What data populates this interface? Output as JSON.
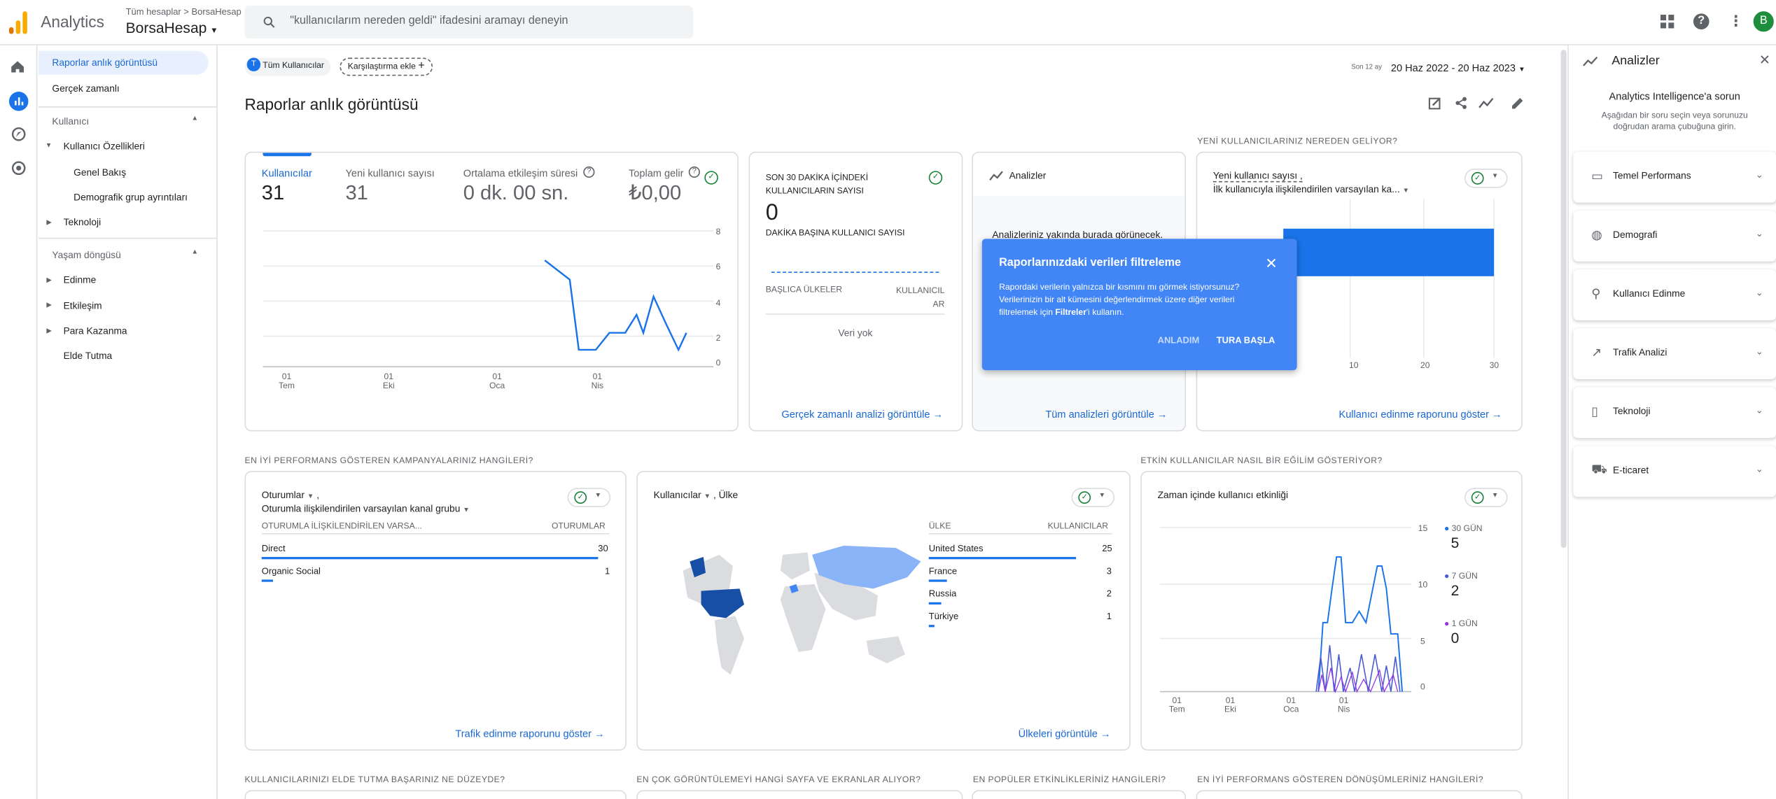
{
  "app": {
    "name": "Analytics",
    "breadcrumb": "Tüm hesaplar > BorsaHesap",
    "account": "BorsaHesap"
  },
  "search": {
    "placeholder": "\"kullanıcılarım nereden geldi\" ifadesini aramayı deneyin"
  },
  "user": {
    "initial": "B"
  },
  "nav": {
    "snapshot": "Raporlar anlık görüntüsü",
    "realtime": "Gerçek zamanlı",
    "user_section": "Kullanıcı",
    "user_attributes": "Kullanıcı Özellikleri",
    "overview": "Genel Bakış",
    "demographic_details": "Demografik grup ayrıntıları",
    "technology": "Teknoloji",
    "lifecycle_section": "Yaşam döngüsü",
    "acquisition": "Edinme",
    "engagement": "Etkileşim",
    "monetization": "Para Kazanma",
    "retention": "Elde Tutma"
  },
  "filters": {
    "all_users": "Tüm Kullanıcılar",
    "all_users_badge": "T",
    "add_comparison": "Karşılaştırma ekle",
    "date_prefix": "Son 12 ay",
    "date_range": "20 Haz 2022 - 20 Haz 2023"
  },
  "page_title": "Raporlar anlık görüntüsü",
  "kpi": {
    "users_label": "Kullanıcılar",
    "users_value": "31",
    "new_users_label": "Yeni kullanıcı sayısı",
    "new_users_value": "31",
    "avg_engagement_label": "Ortalama etkileşim süresi",
    "avg_engagement_value": "0 dk. 00 sn.",
    "revenue_label": "Toplam gelir",
    "revenue_value": "₺0,00",
    "y_ticks": [
      "8",
      "6",
      "4",
      "2",
      "0"
    ],
    "x_ticks": [
      {
        "d": "01",
        "m": "Tem"
      },
      {
        "d": "01",
        "m": "Eki"
      },
      {
        "d": "01",
        "m": "Oca"
      },
      {
        "d": "01",
        "m": "Nis"
      }
    ]
  },
  "realtime": {
    "title_line1": "SON 30 DAKİKA İÇİNDEKİ",
    "title_line2": "KULLANICILARIN SAYISI",
    "value": "0",
    "per_minute": "DAKİKA BAŞINA KULLANICI SAYISI",
    "col_country": "BAŞLICA ÜLKELER",
    "col_users_1": "KULLANICIL",
    "col_users_2": "AR",
    "empty": "Veri yok",
    "link": "Gerçek zamanlı analizi görüntüle"
  },
  "insights": {
    "title": "Analizler",
    "soon": "Analizleriniz yakında burada görünecek.",
    "link": "Tüm analizleri görüntüle"
  },
  "tooltip": {
    "title": "Raporlarınızdaki verileri filtreleme",
    "body_1": "Rapordaki verilerin yalnızca bir kısmını mı görmek istiyorsunuz?",
    "body_2": "Verilerinizin bir alt kümesini değerlendirmek üzere diğer verileri",
    "body_3_pre": "filtrelemek için ",
    "body_3_bold": "Filtreler",
    "body_3_post": "'i kullanın.",
    "dismiss": "ANLADIM",
    "start": "TURA BAŞLA"
  },
  "new_users": {
    "section": "YENİ KULLANICILARINIZ NEREDEN GELİYOR?",
    "metric": "Yeni kullanıcı sayısı",
    "dimension": "İlk kullanıcıyla ilişkilendirilen varsayılan ka...",
    "x_ticks": [
      "10",
      "20",
      "30"
    ],
    "link": "Kullanıcı edinme raporunu göster"
  },
  "campaigns": {
    "section": "EN İYİ PERFORMANS GÖSTEREN KAMPANYALARINIZ HANGİLERİ?",
    "metric": "Oturumlar",
    "dimension": "Oturumla ilişkilendirilen varsayılan kanal grubu",
    "col_dim": "OTURUMLA İLİŞKİLENDİRİLEN VARSA...",
    "col_val": "OTURUMLAR",
    "rows": [
      {
        "name": "Direct",
        "value": "30",
        "fraction": 1
      },
      {
        "name": "Organic Social",
        "value": "1",
        "fraction": 0.033
      }
    ],
    "link": "Trafik edinme raporunu göster"
  },
  "countries": {
    "metric": "Kullanıcılar",
    "dimension": ", Ülke",
    "col_country": "ÜLKE",
    "col_users": "KULLANICILAR",
    "rows": [
      {
        "name": "United States",
        "value": "25",
        "fraction": 1
      },
      {
        "name": "France",
        "value": "3",
        "fraction": 0.12
      },
      {
        "name": "Russia",
        "value": "2",
        "fraction": 0.08
      },
      {
        "name": "Türkiye",
        "value": "1",
        "fraction": 0.04
      }
    ],
    "link": "Ülkeleri görüntüle"
  },
  "active": {
    "section": "ETKİN KULLANICILAR NASIL BİR EĞİLİM GÖSTERİYOR?",
    "title": "Zaman içinde kullanıcı etkinliği",
    "y_ticks": [
      "15",
      "10",
      "5",
      "0"
    ],
    "x_ticks": [
      {
        "d": "01",
        "m": "Tem"
      },
      {
        "d": "01",
        "m": "Eki"
      },
      {
        "d": "01",
        "m": "Oca"
      },
      {
        "d": "01",
        "m": "Nis"
      }
    ],
    "legend": [
      {
        "label": "30 GÜN",
        "value": "5",
        "color": "#1a73e8"
      },
      {
        "label": "7 GÜN",
        "value": "2",
        "color": "#4b5dd3"
      },
      {
        "label": "1 GÜN",
        "value": "0",
        "color": "#9334e6"
      }
    ]
  },
  "bottom_sections": [
    "KULLANICILARINIZI ELDE TUTMA BAŞARINIZ NE DÜZEYDE?",
    "EN ÇOK GÖRÜNTÜLEMEYİ HANGİ SAYFA VE EKRANLAR ALIYOR?",
    "EN POPÜLER ETKİNLİKLERİNİZ HANGİLERİ?",
    "EN İYİ PERFORMANS GÖSTEREN DÖNÜŞÜMLERİNİZ HANGİLERİ?"
  ],
  "right_panel": {
    "title": "Analizler",
    "heading": "Analytics Intelligence'a sorun",
    "sub_1": "Aşağıdan bir soru seçin veya sorunuzu",
    "sub_2": "doğrudan arama çubuğuna girin.",
    "items": [
      "Temel Performans",
      "Demografi",
      "Kullanıcı Edinme",
      "Trafik Analizi",
      "Teknoloji",
      "E-ticaret"
    ]
  },
  "colors": {
    "accent": "#1a73e8",
    "tooltip": "#4285f4",
    "map_us": "#174ea6",
    "map_ru": "#8ab4f8",
    "map_base": "#dadce0"
  }
}
